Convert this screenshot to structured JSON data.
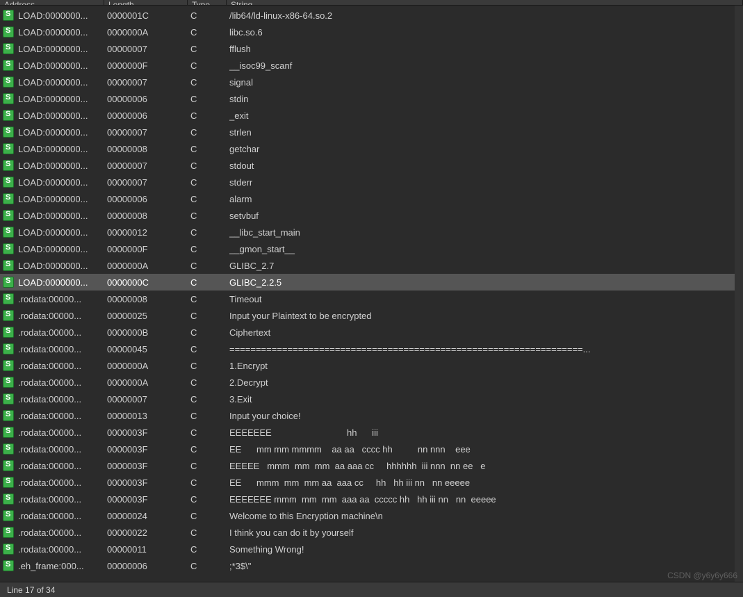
{
  "columns": {
    "address": "Address",
    "length": "Length",
    "type": "Type",
    "string": "String"
  },
  "rows": [
    {
      "address": "LOAD:0000000...",
      "length": "0000001C",
      "type": "C",
      "string": "/lib64/ld-linux-x86-64.so.2"
    },
    {
      "address": "LOAD:0000000...",
      "length": "0000000A",
      "type": "C",
      "string": "libc.so.6"
    },
    {
      "address": "LOAD:0000000...",
      "length": "00000007",
      "type": "C",
      "string": "fflush"
    },
    {
      "address": "LOAD:0000000...",
      "length": "0000000F",
      "type": "C",
      "string": "__isoc99_scanf"
    },
    {
      "address": "LOAD:0000000...",
      "length": "00000007",
      "type": "C",
      "string": "signal"
    },
    {
      "address": "LOAD:0000000...",
      "length": "00000006",
      "type": "C",
      "string": "stdin"
    },
    {
      "address": "LOAD:0000000...",
      "length": "00000006",
      "type": "C",
      "string": "_exit"
    },
    {
      "address": "LOAD:0000000...",
      "length": "00000007",
      "type": "C",
      "string": "strlen"
    },
    {
      "address": "LOAD:0000000...",
      "length": "00000008",
      "type": "C",
      "string": "getchar"
    },
    {
      "address": "LOAD:0000000...",
      "length": "00000007",
      "type": "C",
      "string": "stdout"
    },
    {
      "address": "LOAD:0000000...",
      "length": "00000007",
      "type": "C",
      "string": "stderr"
    },
    {
      "address": "LOAD:0000000...",
      "length": "00000006",
      "type": "C",
      "string": "alarm"
    },
    {
      "address": "LOAD:0000000...",
      "length": "00000008",
      "type": "C",
      "string": "setvbuf"
    },
    {
      "address": "LOAD:0000000...",
      "length": "00000012",
      "type": "C",
      "string": "__libc_start_main"
    },
    {
      "address": "LOAD:0000000...",
      "length": "0000000F",
      "type": "C",
      "string": "__gmon_start__"
    },
    {
      "address": "LOAD:0000000...",
      "length": "0000000A",
      "type": "C",
      "string": "GLIBC_2.7"
    },
    {
      "address": "LOAD:0000000...",
      "length": "0000000C",
      "type": "C",
      "string": "GLIBC_2.2.5",
      "selected": true
    },
    {
      "address": ".rodata:00000...",
      "length": "00000008",
      "type": "C",
      "string": "Timeout"
    },
    {
      "address": ".rodata:00000...",
      "length": "00000025",
      "type": "C",
      "string": "Input your Plaintext to be encrypted"
    },
    {
      "address": ".rodata:00000...",
      "length": "0000000B",
      "type": "C",
      "string": "Ciphertext"
    },
    {
      "address": ".rodata:00000...",
      "length": "00000045",
      "type": "C",
      "string": "===================================================================..."
    },
    {
      "address": ".rodata:00000...",
      "length": "0000000A",
      "type": "C",
      "string": "1.Encrypt"
    },
    {
      "address": ".rodata:00000...",
      "length": "0000000A",
      "type": "C",
      "string": "2.Decrypt"
    },
    {
      "address": ".rodata:00000...",
      "length": "00000007",
      "type": "C",
      "string": "3.Exit"
    },
    {
      "address": ".rodata:00000...",
      "length": "00000013",
      "type": "C",
      "string": "Input your choice!"
    },
    {
      "address": ".rodata:00000...",
      "length": "0000003F",
      "type": "C",
      "string": "EEEEEEE                              hh      iii                "
    },
    {
      "address": ".rodata:00000...",
      "length": "0000003F",
      "type": "C",
      "string": "EE      mm mm mmmm    aa aa   cccc hh          nn nnn    eee    "
    },
    {
      "address": ".rodata:00000...",
      "length": "0000003F",
      "type": "C",
      "string": "EEEEE   mmm  mm  mm  aa aaa cc     hhhhhh  iii nnn  nn ee   e   "
    },
    {
      "address": ".rodata:00000...",
      "length": "0000003F",
      "type": "C",
      "string": "EE      mmm  mm  mm aa  aaa cc     hh   hh iii nn   nn eeeee    "
    },
    {
      "address": ".rodata:00000...",
      "length": "0000003F",
      "type": "C",
      "string": "EEEEEEE mmm  mm  mm  aaa aa  ccccc hh   hh iii nn   nn  eeeee   "
    },
    {
      "address": ".rodata:00000...",
      "length": "00000024",
      "type": "C",
      "string": "Welcome to this Encryption machine\\n"
    },
    {
      "address": ".rodata:00000...",
      "length": "00000022",
      "type": "C",
      "string": "I think you can do it by yourself"
    },
    {
      "address": ".rodata:00000...",
      "length": "00000011",
      "type": "C",
      "string": "Something Wrong!"
    },
    {
      "address": ".eh_frame:000...",
      "length": "00000006",
      "type": "C",
      "string": ";*3$\\\""
    }
  ],
  "status": {
    "text": "Line 17 of 34"
  },
  "watermark": "CSDN @y6y6y666"
}
